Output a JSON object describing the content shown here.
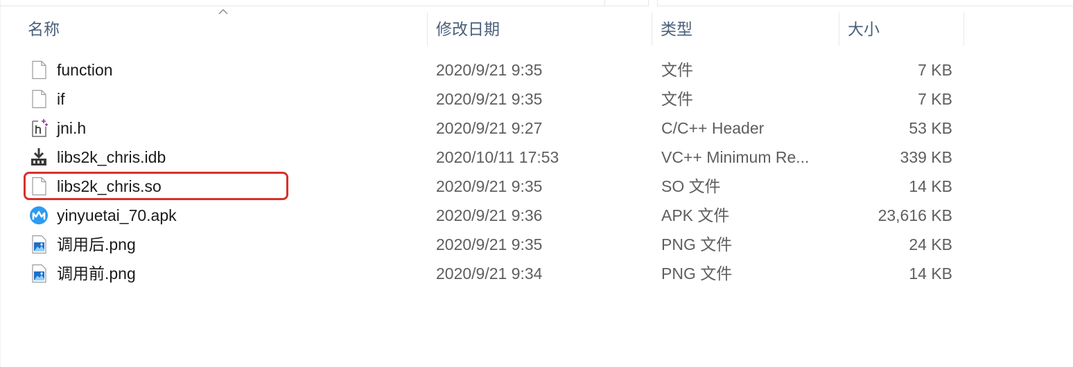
{
  "columns": {
    "name": "名称",
    "date": "修改日期",
    "type": "类型",
    "size": "大小"
  },
  "files": [
    {
      "name": "function",
      "date": "2020/9/21 9:35",
      "type": "文件",
      "size": "7 KB",
      "icon": "blank-file-icon"
    },
    {
      "name": "if",
      "date": "2020/9/21 9:35",
      "type": "文件",
      "size": "7 KB",
      "icon": "blank-file-icon"
    },
    {
      "name": "jni.h",
      "date": "2020/9/21 9:27",
      "type": "C/C++ Header",
      "size": "53 KB",
      "icon": "cpp-header-file-icon"
    },
    {
      "name": "libs2k_chris.idb",
      "date": "2020/10/11 17:53",
      "type": "VC++ Minimum Re...",
      "size": "339 KB",
      "icon": "database-file-icon"
    },
    {
      "name": "libs2k_chris.so",
      "date": "2020/9/21 9:35",
      "type": "SO 文件",
      "size": "14 KB",
      "icon": "blank-file-icon",
      "highlighted": true
    },
    {
      "name": "yinyuetai_70.apk",
      "date": "2020/9/21 9:36",
      "type": "APK 文件",
      "size": "23,616 KB",
      "icon": "yinyuetai-app-icon"
    },
    {
      "name": "调用后.png",
      "date": "2020/9/21 9:35",
      "type": "PNG 文件",
      "size": "24 KB",
      "icon": "image-file-icon"
    },
    {
      "name": "调用前.png",
      "date": "2020/9/21 9:34",
      "type": "PNG 文件",
      "size": "14 KB",
      "icon": "image-file-icon"
    }
  ],
  "colors": {
    "highlight_border": "#d9302a",
    "header_text": "#4a5f7a",
    "apk_icon": "#2d9bf0"
  }
}
